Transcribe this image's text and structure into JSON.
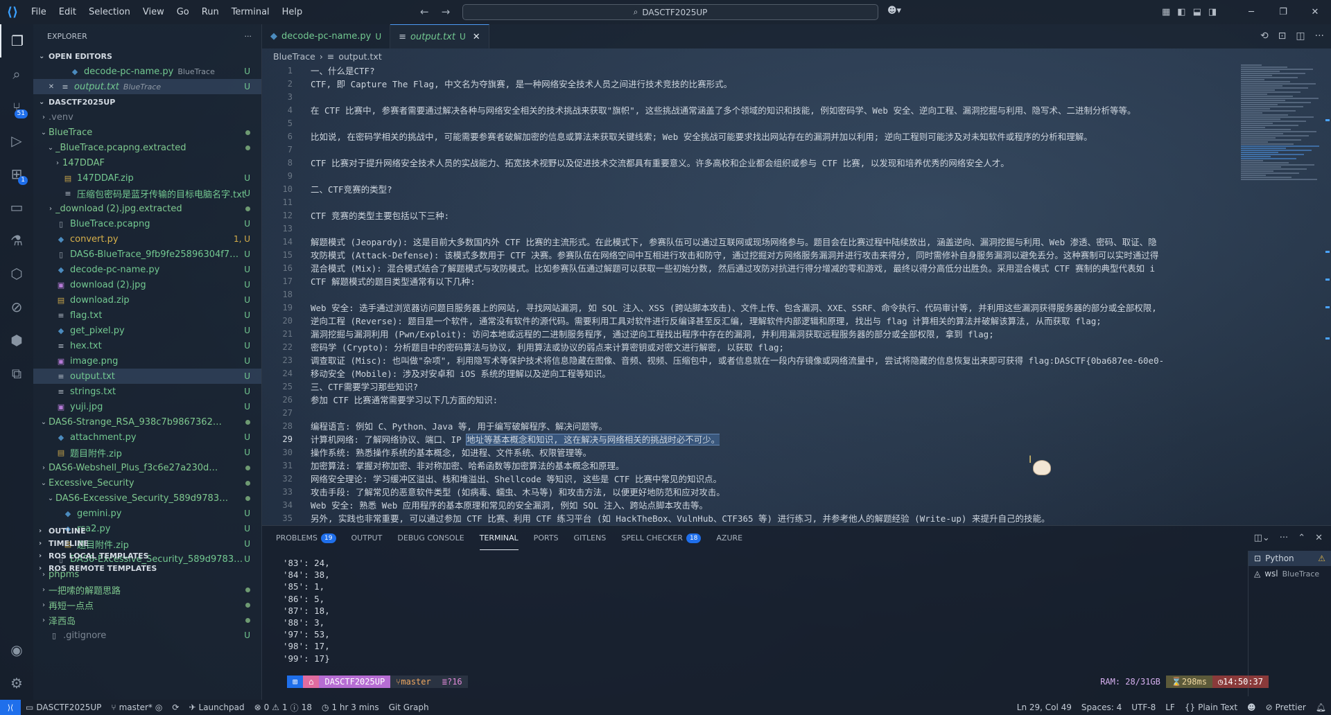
{
  "title_bar": {
    "menu": [
      "File",
      "Edit",
      "Selection",
      "View",
      "Go",
      "Run",
      "Terminal",
      "Help"
    ],
    "search_text": "DASCTF2025UP"
  },
  "activity_bar": {
    "source_control_badge": "51",
    "extensions_badge": "1"
  },
  "sidebar": {
    "header": "EXPLORER",
    "open_editors_label": "OPEN EDITORS",
    "open_editors": [
      {
        "name": "decode-pc-name.py",
        "hint": "BlueTrace",
        "status": "U"
      },
      {
        "name": "output.txt",
        "hint": "BlueTrace",
        "status": "U"
      }
    ],
    "workspace_label": "DASCTF2025UP",
    "tree": [
      {
        "name": ".venv",
        "status": ""
      },
      {
        "name": "BlueTrace",
        "status": ""
      },
      {
        "name": "_BlueTrace.pcapng.extracted",
        "status": ""
      },
      {
        "name": "147DDAF",
        "status": ""
      },
      {
        "name": "147DDAF.zip",
        "status": "U"
      },
      {
        "name": "压缩包密码是蓝牙传输的目标电脑名字.txt",
        "status": "U"
      },
      {
        "name": "_download (2).jpg.extracted",
        "status": ""
      },
      {
        "name": "BlueTrace.pcapng",
        "status": "U"
      },
      {
        "name": "convert.py",
        "status": "1, U"
      },
      {
        "name": "DAS6-BlueTrace_9fb9fe25896304f7ec2d3a3...",
        "status": "U"
      },
      {
        "name": "decode-pc-name.py",
        "status": "U"
      },
      {
        "name": "download (2).jpg",
        "status": "U"
      },
      {
        "name": "download.zip",
        "status": "U"
      },
      {
        "name": "flag.txt",
        "status": "U"
      },
      {
        "name": "get_pixel.py",
        "status": "U"
      },
      {
        "name": "hex.txt",
        "status": "U"
      },
      {
        "name": "image.png",
        "status": "U"
      },
      {
        "name": "output.txt",
        "status": "U"
      },
      {
        "name": "strings.txt",
        "status": "U"
      },
      {
        "name": "yuji.jpg",
        "status": "U"
      },
      {
        "name": "DAS6-Strange_RSA_938c7b986736231ce9fd...",
        "status": ""
      },
      {
        "name": "attachment.py",
        "status": "U"
      },
      {
        "name": "题目附件.zip",
        "status": "U"
      },
      {
        "name": "DAS6-Webshell_Plus_f3c6e27a230d3788c73...",
        "status": ""
      },
      {
        "name": "Excessive_Security",
        "status": ""
      },
      {
        "name": "DAS6-Excessive_Security_589d9783b3a7ae...",
        "status": ""
      },
      {
        "name": "gemini.py",
        "status": "U"
      },
      {
        "name": "rsa2.py",
        "status": "U"
      },
      {
        "name": "题目附件.zip",
        "status": "U"
      },
      {
        "name": "DAS6-Excessive_Security_589d9783b3a7ae...",
        "status": "U"
      },
      {
        "name": "phpms",
        "status": ""
      },
      {
        "name": "一把嗦的解题思路",
        "status": ""
      },
      {
        "name": "再短一点点",
        "status": ""
      },
      {
        "name": "泽西岛",
        "status": ""
      },
      {
        "name": ".gitignore",
        "status": "U"
      }
    ],
    "bottom_sections": [
      "OUTLINE",
      "TIMELINE",
      "ROS LOCAL TEMPLATES",
      "ROS REMOTE TEMPLATES"
    ]
  },
  "tabs": [
    {
      "label": "decode-pc-name.py",
      "status": "U"
    },
    {
      "label": "output.txt",
      "status": "U"
    }
  ],
  "breadcrumb": [
    "BlueTrace",
    "output.txt"
  ],
  "editor": {
    "current_line": 29,
    "lines": [
      "一、什么是CTF?",
      "CTF, 即 Capture The Flag, 中文名为夺旗赛, 是一种网络安全技术人员之间进行技术竞技的比赛形式。",
      "",
      "在 CTF 比赛中, 参赛者需要通过解决各种与网络安全相关的技术挑战来获取\"旗帜\", 这些挑战通常涵盖了多个领域的知识和技能, 例如密码学、Web 安全、逆向工程、漏洞挖掘与利用、隐写术、二进制分析等等。",
      "",
      "比如说, 在密码学相关的挑战中, 可能需要参赛者破解加密的信息或算法来获取关键线索; Web 安全挑战可能要求找出网站存在的漏洞并加以利用; 逆向工程则可能涉及对未知软件或程序的分析和理解。",
      "",
      "CTF 比赛对于提升网络安全技术人员的实战能力、拓宽技术视野以及促进技术交流都具有重要意义。许多高校和企业都会组织或参与 CTF 比赛, 以发现和培养优秀的网络安全人才。",
      "",
      "二、CTF竞赛的类型?",
      "",
      "CTF 竞赛的类型主要包括以下三种:",
      "",
      "解题模式 (Jeopardy): 这是目前大多数国内外 CTF 比赛的主流形式。在此模式下, 参赛队伍可以通过互联网或现场网络参与。题目会在比赛过程中陆续放出, 涵盖逆向、漏洞挖掘与利用、Web 渗透、密码、取证、隐",
      "攻防模式 (Attack-Defense): 该模式多数用于 CTF 决赛。参赛队伍在网络空间中互相进行攻击和防守, 通过挖掘对方网络服务漏洞并进行攻击来得分, 同时需修补自身服务漏洞以避免丢分。这种赛制可以实时通过得",
      "混合模式 (Mix): 混合模式结合了解题模式与攻防模式。比如参赛队伍通过解题可以获取一些初始分数, 然后通过攻防对抗进行得分增减的零和游戏, 最终以得分高低分出胜负。采用混合模式 CTF 赛制的典型代表如 i",
      "CTF 解题模式的题目类型通常有以下几种:",
      "",
      "Web 安全: 选手通过浏览器访问题目服务器上的网站, 寻找网站漏洞, 如 SQL 注入、XSS (跨站脚本攻击)、文件上传、包含漏洞、XXE、SSRF、命令执行、代码审计等, 并利用这些漏洞获得服务器的部分或全部权限,",
      "逆向工程 (Reverse): 题目是一个软件, 通常没有软件的源代码。需要利用工具对软件进行反编译甚至反汇编, 理解软件内部逻辑和原理, 找出与 flag 计算相关的算法并破解该算法, 从而获取 flag;",
      "漏洞挖掘与漏洞利用 (Pwn/Exploit): 访问本地或远程的二进制服务程序, 通过逆向工程找出程序中存在的漏洞, 并利用漏洞获取远程服务器的部分或全部权限, 拿到 flag;",
      "密码学 (Crypto): 分析题目中的密码算法与协议, 利用算法或协议的弱点来计算密钥或对密文进行解密, 以获取 flag;",
      "调查取证 (Misc): 也叫做\"杂项\", 利用隐写术等保护技术将信息隐藏在图像、音频、视频、压缩包中, 或者信息就在一段内存镜像或网络流量中, 尝试将隐藏的信息恢复出来即可获得 flag:DASCTF{0ba687ee-60e0-",
      "移动安全 (Mobile): 涉及对安卓和 iOS 系统的理解以及逆向工程等知识。",
      "三、CTF需要学习那些知识?",
      "参加 CTF 比赛通常需要学习以下几方面的知识:",
      "",
      "编程语言: 例如 C、Python、Java 等, 用于编写破解程序、解决问题等。",
      "计算机网络: 了解网络协议、端口、IP 地址等基本概念和知识, 这在解决与网络相关的挑战时必不可少。",
      "操作系统: 熟悉操作系统的基本概念, 如进程、文件系统、权限管理等。",
      "加密算法: 掌握对称加密、非对称加密、哈希函数等加密算法的基本概念和原理。",
      "网络安全理论: 学习缓冲区溢出、栈和堆溢出、Shellcode 等知识, 这些是 CTF 比赛中常见的知识点。",
      "攻击手段: 了解常见的恶意软件类型 (如病毒、蠕虫、木马等) 和攻击方法, 以便更好地防范和应对攻击。",
      "Web 安全: 熟悉 Web 应用程序的基本原理和常见的安全漏洞, 例如 SQL 注入、跨站点脚本攻击等。",
      "另外, 实践也非常重要, 可以通过参加 CTF 比赛、利用 CTF 练习平台 (如 HackTheBox、VulnHub、CTF365 等) 进行练习, 并参考他人的解题经验 (Write-up) 来提升自己的技能。"
    ]
  },
  "panel": {
    "tabs": [
      {
        "label": "PROBLEMS",
        "badge": "19"
      },
      {
        "label": "OUTPUT",
        "badge": ""
      },
      {
        "label": "DEBUG CONSOLE",
        "badge": ""
      },
      {
        "label": "TERMINAL",
        "badge": ""
      },
      {
        "label": "PORTS",
        "badge": ""
      },
      {
        "label": "GITLENS",
        "badge": ""
      },
      {
        "label": "SPELL CHECKER",
        "badge": "18"
      },
      {
        "label": "AZURE",
        "badge": ""
      }
    ],
    "terminal_lines": [
      "'83': 24,",
      "'84': 38,",
      "'85': 1,",
      "'86': 5,",
      "'87': 18,",
      "'88': 3,",
      "'97': 53,",
      "'98': 17,",
      "'99': 17}"
    ],
    "prompt": {
      "dir": "DASCTF2025UP",
      "branch": "master",
      "changes": "?16",
      "ram": "RAM: 28/31GB",
      "duration": "298ms",
      "time": "14:50:37"
    },
    "terminals": [
      {
        "label": "Python"
      },
      {
        "label": "wsl",
        "hint": "BlueTrace"
      }
    ]
  },
  "statusbar": {
    "workspace": "DASCTF2025UP",
    "branch": "master*",
    "launchpad": "Launchpad",
    "errors": "0",
    "warnings": "1",
    "info": "18",
    "time_tracker": "1 hr 3 mins",
    "git_graph": "Git Graph",
    "position": "Ln 29, Col 49",
    "spaces": "Spaces: 4",
    "encoding": "UTF-8",
    "eol": "LF",
    "language": "Plain Text",
    "prettier": "Prettier"
  }
}
